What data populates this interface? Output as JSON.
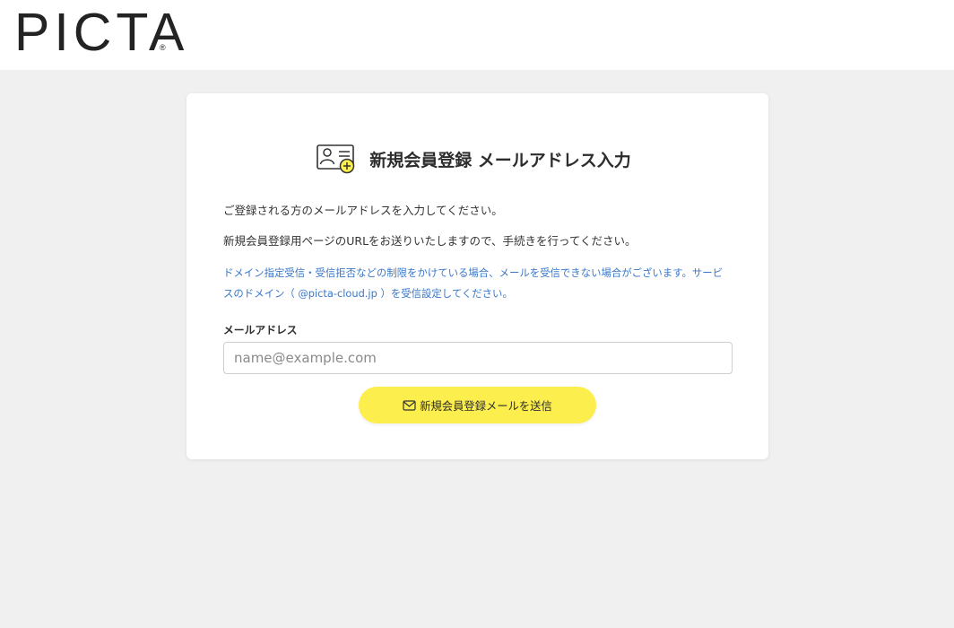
{
  "header": {
    "logo_text": "PICTA",
    "logo_reg": "®"
  },
  "card": {
    "title": "新規会員登録 メールアドレス入力",
    "title_icon": "user-card-add-icon",
    "description_1": "ご登録される方のメールアドレスを入力してください。",
    "description_2": "新規会員登録用ページのURLをお送りいたしますので、手続きを行ってください。",
    "notice_line_1": "ドメイン指定受信・受信拒否などの制限をかけている場合、メールを受信できない場合がございます。サービ",
    "notice_line_2": "スのドメイン（ @picta-cloud.jp ）を受信設定してください。",
    "notice_color": "#3a78c9",
    "email_label": "メールアドレス",
    "email_placeholder": "name@example.com",
    "email_value": "",
    "submit_label": "新規会員登録メールを送信",
    "submit_icon": "envelope-icon",
    "accent_color": "#fcee4d"
  }
}
